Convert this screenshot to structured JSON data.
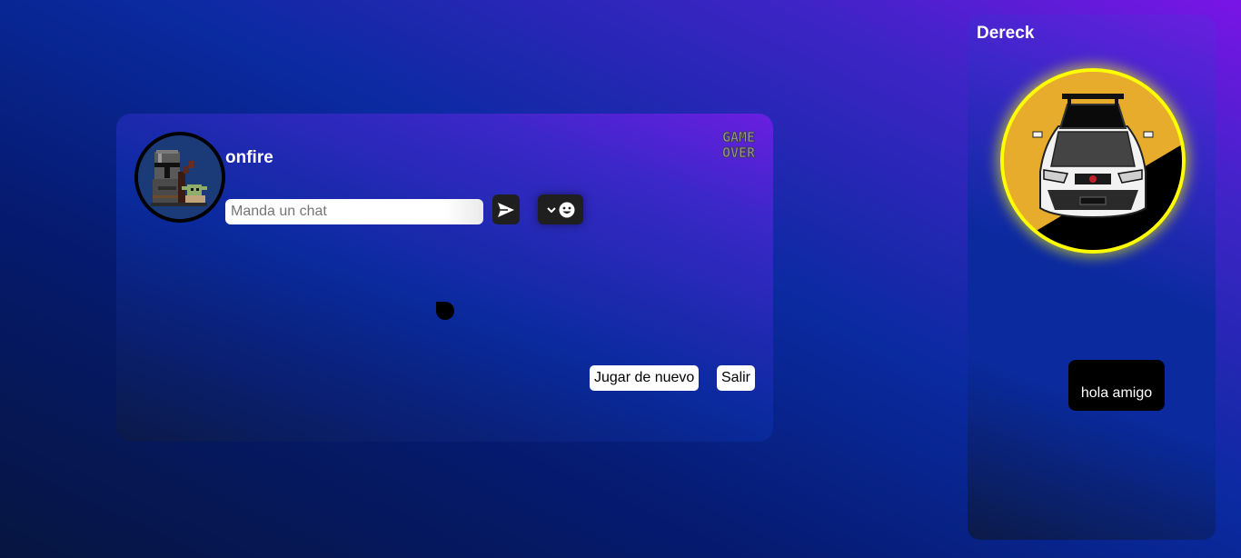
{
  "game": {
    "player_name": "onfire",
    "chat_placeholder": "Manda un chat",
    "chat_value": "",
    "send_icon": "send-icon",
    "emoji_icon": "smiley-icon",
    "emoji_toggle_icon": "chevron-down-icon",
    "game_over_logo": {
      "line1": "GAME",
      "line2": "OVER"
    },
    "replay_label": "Jugar de nuevo",
    "exit_label": "Salir"
  },
  "opponent": {
    "name": "Dereck",
    "message": "hola amigo",
    "avatar_ring_color": "#ffff00"
  },
  "colors": {
    "background_top_right": "#7a14e6",
    "background_mid": "#0a2aa0",
    "background_bottom": "#061540",
    "button_dark": "#1f1f1f",
    "bubble": "#000000"
  }
}
